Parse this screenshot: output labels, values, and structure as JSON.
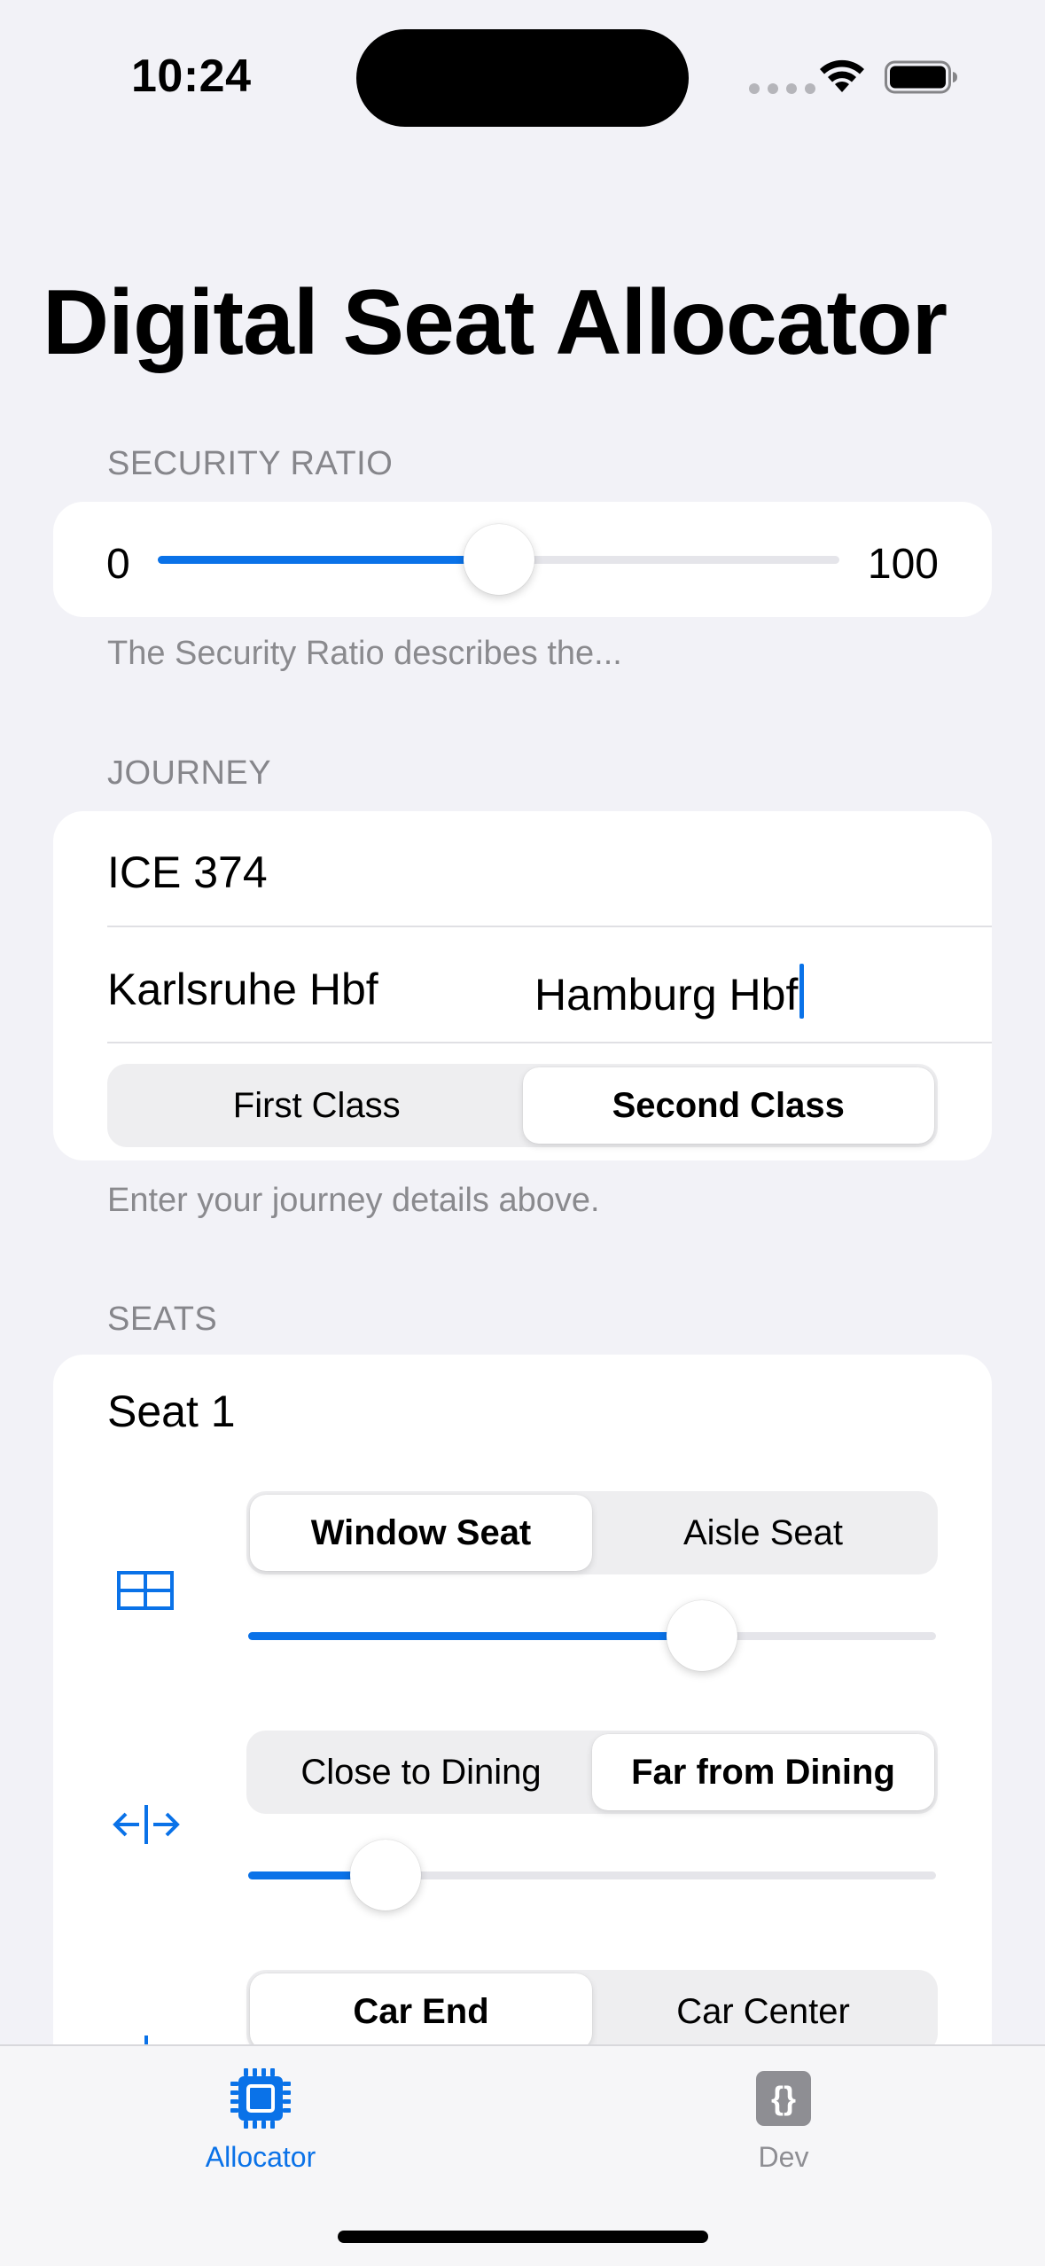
{
  "status_bar": {
    "time": "10:24"
  },
  "page": {
    "title": "Digital Seat Allocator"
  },
  "security": {
    "header": "SECURITY RATIO",
    "min_label": "0",
    "max_label": "100",
    "value": 50,
    "footer": "The Security Ratio describes the..."
  },
  "journey": {
    "header": "JOURNEY",
    "train": "ICE 374",
    "origin": "Karlsruhe Hbf",
    "destination": "Hamburg Hbf",
    "class_options": [
      "First Class",
      "Second Class"
    ],
    "selected_class": "Second Class",
    "footer": "Enter your journey details above."
  },
  "seats": {
    "header": "SEATS",
    "seat_title": "Seat 1",
    "preferences": [
      {
        "icon": "window-grid-icon",
        "options": [
          "Window Seat",
          "Aisle Seat"
        ],
        "selected": "Window Seat",
        "value": 0.66
      },
      {
        "icon": "arrows-left-right-icon",
        "options": [
          "Close to Dining",
          "Far from Dining"
        ],
        "selected": "Far from Dining",
        "value": 0.2
      },
      {
        "icon": "car-position-icon",
        "options": [
          "Car End",
          "Car Center"
        ],
        "selected": "Car End"
      }
    ]
  },
  "tab_bar": {
    "tabs": [
      {
        "label": "Allocator",
        "icon": "chip-icon",
        "active": true
      },
      {
        "label": "Dev",
        "icon": "curly-braces-icon",
        "active": false
      }
    ]
  },
  "colors": {
    "accent": "#0a72e8",
    "inactive": "#8e8e93",
    "background": "#f2f2f7"
  }
}
